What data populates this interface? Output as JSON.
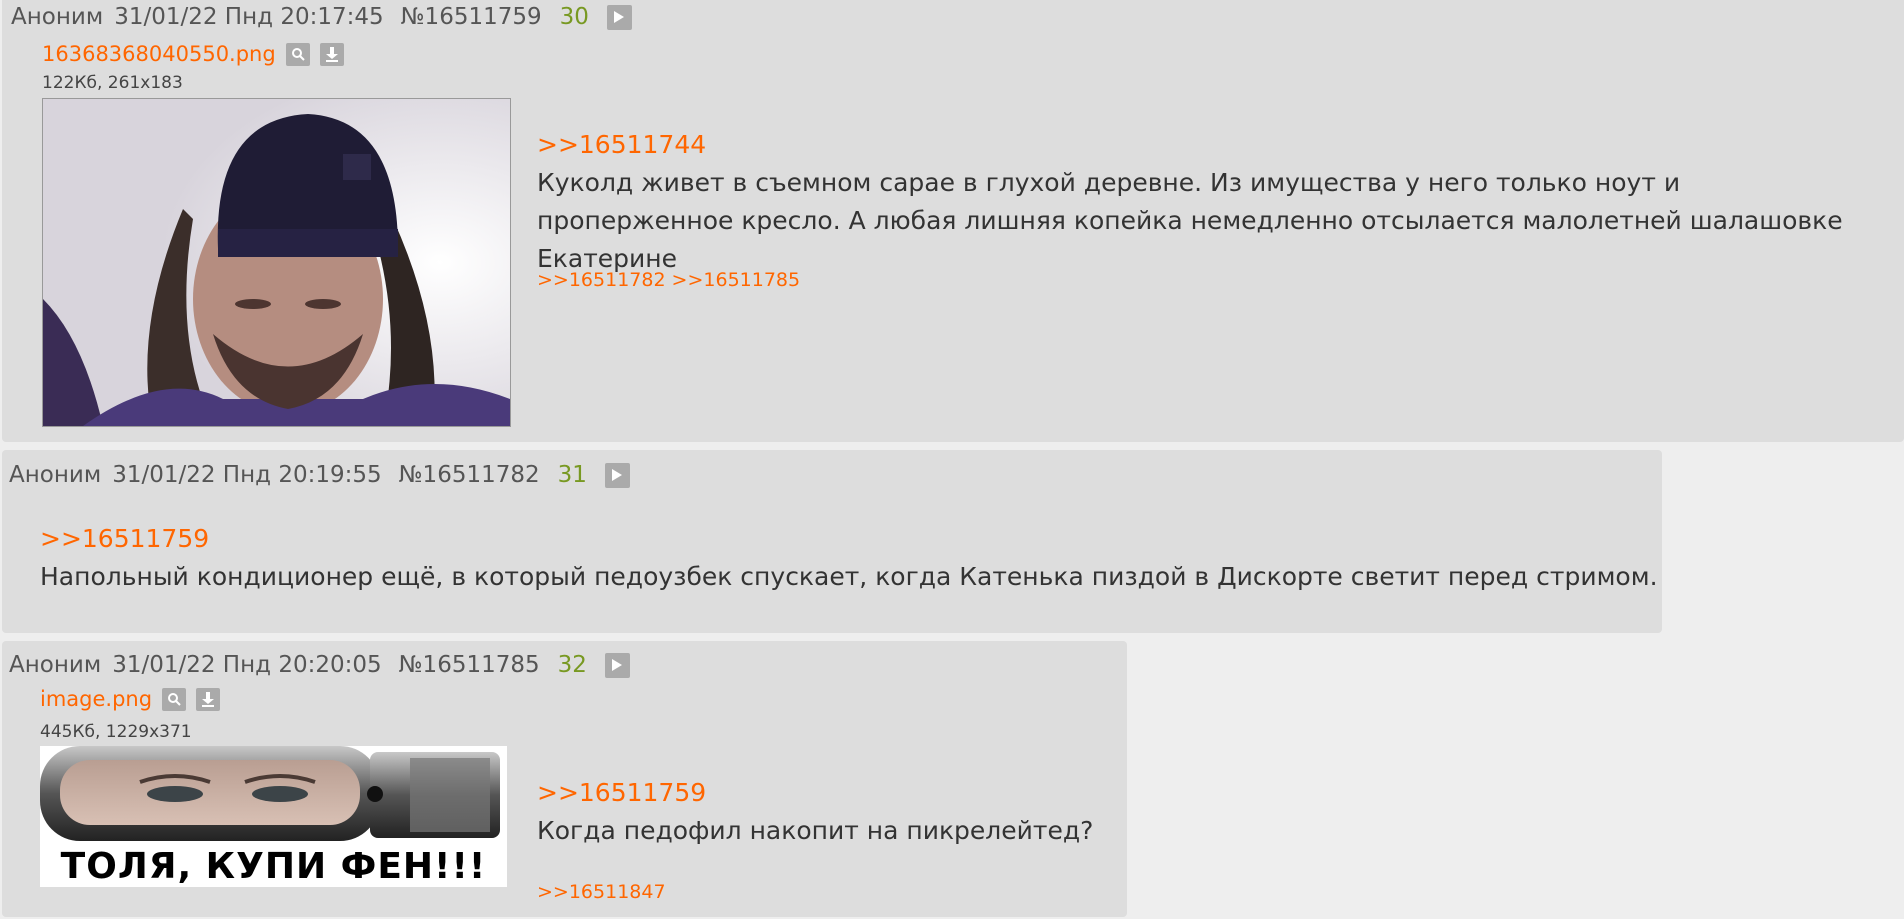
{
  "posts": [
    {
      "author": "Аноним",
      "date": "31/01/22 Пнд 20:17:45",
      "number": "№16511759",
      "count": "30",
      "file": {
        "name": "16368368040550.png",
        "meta": "122Кб, 261x183"
      },
      "reply_to": ">>16511744",
      "text": "Куколд живет в съемном сарае в глухой деревне. Из имущества у него только ноут и проперженное кресло. А любая лишняя копейка немедленно отсылается малолетней шалашовке Екатерине",
      "backlinks": [
        ">>16511782",
        ">>16511785"
      ]
    },
    {
      "author": "Аноним",
      "date": "31/01/22 Пнд 20:19:55",
      "number": "№16511782",
      "count": "31",
      "reply_to": ">>16511759",
      "text": "Напольный кондиционер ещё, в который педоузбек спускает, когда Катенька пиздой в Дискорте светит перед стримом."
    },
    {
      "author": "Аноним",
      "date": "31/01/22 Пнд 20:20:05",
      "number": "№16511785",
      "count": "32",
      "file": {
        "name": "image.png",
        "meta": "445Кб, 1229x371",
        "caption": "ТОЛЯ, КУПИ ФЕН!!!"
      },
      "reply_to": ">>16511759",
      "text": "Когда педофил накопит на пикрелейтед?",
      "backlinks": [
        ">>16511847"
      ]
    }
  ],
  "colors": {
    "link": "#ff6600",
    "count": "#789922",
    "post_bg": "#dddddd",
    "page_bg": "#eeeeee"
  }
}
